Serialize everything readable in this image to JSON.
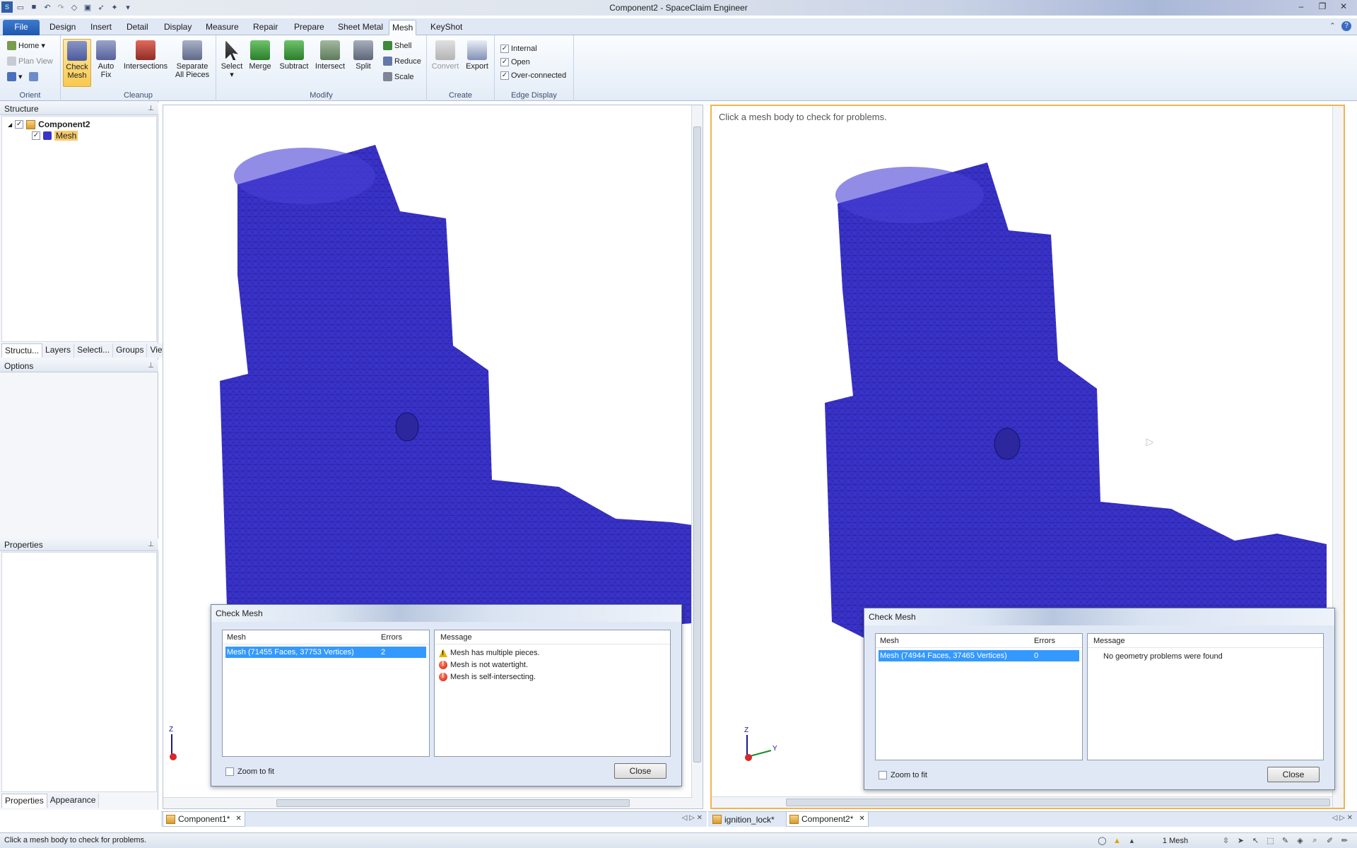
{
  "window": {
    "title": "Component2 - SpaceClaim Engineer"
  },
  "menu_tabs": [
    "File",
    "Design",
    "Insert",
    "Detail",
    "Display",
    "Measure",
    "Repair",
    "Prepare",
    "Sheet Metal",
    "Mesh",
    "KeyShot"
  ],
  "active_tab": "Mesh",
  "ribbon": {
    "orient": {
      "label": "Orient",
      "home": "Home",
      "plan_view": "Plan View"
    },
    "cleanup": {
      "label": "Cleanup",
      "check_mesh": [
        "Check",
        "Mesh"
      ],
      "auto_fix": [
        "Auto",
        "Fix"
      ],
      "intersections": "Intersections",
      "separate": [
        "Separate",
        "All Pieces"
      ]
    },
    "modify": {
      "label": "Modify",
      "select": "Select",
      "merge": "Merge",
      "subtract": "Subtract",
      "intersect": "Intersect",
      "split": "Split",
      "shell": "Shell",
      "reduce": "Reduce",
      "scale": "Scale"
    },
    "create": {
      "label": "Create",
      "convert": "Convert",
      "export": "Export"
    },
    "edge_display": {
      "label": "Edge Display",
      "internal": "Internal",
      "open": "Open",
      "over_connected": "Over-connected"
    }
  },
  "structure_panel": {
    "title": "Structure",
    "root": "Component2",
    "child": "Mesh",
    "tabs": [
      "Structu...",
      "Layers",
      "Selecti...",
      "Groups",
      "Views"
    ]
  },
  "options_panel": {
    "title": "Options"
  },
  "properties_panel": {
    "title": "Properties",
    "tabs": [
      "Properties",
      "Appearance"
    ]
  },
  "right_viewport": {
    "message": "Click a mesh body to check for problems."
  },
  "check_mesh_left": {
    "title": "Check Mesh",
    "col_mesh": "Mesh",
    "col_errors": "Errors",
    "col_message": "Message",
    "row_mesh": "Mesh (71455 Faces, 37753 Vertices)",
    "row_errors": "2",
    "messages": [
      "Mesh has multiple pieces.",
      "Mesh is not watertight.",
      "Mesh is self-intersecting."
    ],
    "zoom_to_fit": "Zoom to fit",
    "close": "Close"
  },
  "check_mesh_right": {
    "title": "Check Mesh",
    "col_mesh": "Mesh",
    "col_errors": "Errors",
    "col_message": "Message",
    "row_mesh": "Mesh (74944 Faces, 37465 Vertices)",
    "row_errors": "0",
    "messages": [
      "No geometry problems were found"
    ],
    "zoom_to_fit": "Zoom to fit",
    "close": "Close"
  },
  "doc_tabs_left": [
    "Component1*"
  ],
  "doc_tabs_right": [
    "ignition_lock*",
    "Component2*"
  ],
  "status": {
    "message": "Click a mesh body to check for problems.",
    "selection": "1 Mesh"
  },
  "colors": {
    "mesh": "#3a33c9",
    "accent": "#f2b44d",
    "selection": "#3399ff"
  }
}
